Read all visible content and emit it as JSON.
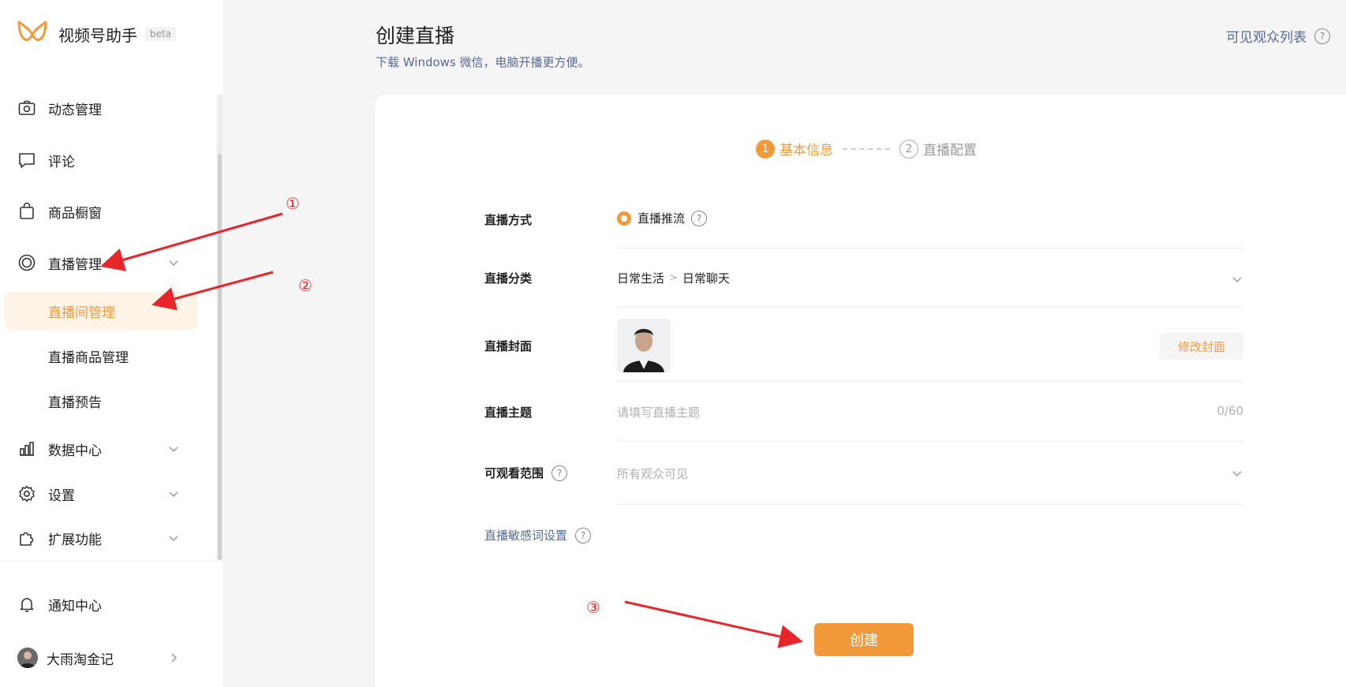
{
  "app": {
    "title": "视频号助手",
    "badge": "beta"
  },
  "sidebar": {
    "items": [
      {
        "label": "动态管理",
        "icon": "camera-icon"
      },
      {
        "label": "评论",
        "icon": "comment-icon"
      },
      {
        "label": "商品橱窗",
        "icon": "shopping-bag-icon"
      },
      {
        "label": "直播管理",
        "icon": "live-ring-icon"
      },
      {
        "label": "数据中心",
        "icon": "bar-chart-icon"
      },
      {
        "label": "设置",
        "icon": "gear-icon"
      },
      {
        "label": "扩展功能",
        "icon": "puzzle-icon"
      }
    ],
    "sub_items": [
      {
        "label": "直播间管理",
        "active": true
      },
      {
        "label": "直播商品管理",
        "active": false
      },
      {
        "label": "直播预告",
        "active": false
      }
    ],
    "notification": "通知中心",
    "account_name": "大雨淘金记"
  },
  "header": {
    "title": "创建直播",
    "subtitle": "下载 Windows 微信，电脑开播更方便。",
    "viewer_list": "可见观众列表",
    "help_glyph": "?"
  },
  "steps": [
    {
      "num": "1",
      "label": "基本信息",
      "active": true
    },
    {
      "num": "2",
      "label": "直播配置",
      "active": false
    }
  ],
  "form": {
    "mode_label": "直播方式",
    "mode_value": "直播推流",
    "category_label": "直播分类",
    "category_main": "日常生活",
    "category_sep": ">",
    "category_sub": "日常聊天",
    "cover_label": "直播封面",
    "cover_button": "修改封面",
    "topic_label": "直播主题",
    "topic_placeholder": "请填写直播主题",
    "topic_counter": "0/60",
    "range_label": "可观看范围",
    "range_value": "所有观众可见",
    "sensitive_label": "直播敏感词设置"
  },
  "create_button": "创建",
  "annotations": [
    "①",
    "②",
    "③"
  ],
  "colors": {
    "accent": "#f29a3a",
    "link": "#576b95",
    "annotation": "#e8252a"
  }
}
